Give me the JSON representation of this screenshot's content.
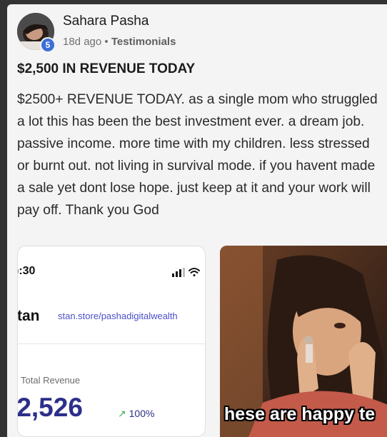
{
  "post": {
    "author": "Sahara Pasha",
    "level": "5",
    "time_ago": "18d ago",
    "separator": "•",
    "category": "Testimonials",
    "title": "$2,500 IN REVENUE TODAY",
    "body": "$2500+ REVENUE TODAY. as a single mom who struggled a lot this has been the best investment ever. a dream job. passive income. more time with my children. less stressed or burnt out. not living in survival mode. if you havent made a sale yet dont lose hope. just keep at it and your work will pay off. Thank you God"
  },
  "attachments": {
    "screenshot": {
      "time": "):30",
      "brand": "ˈtan",
      "store_url": "stan.store/pashadigitalwealth",
      "revenue_label": "Total Revenue",
      "revenue_value": "ˈ2,526",
      "growth": "100%",
      "growth_icon": "trend-up-arrow",
      "status_icons": [
        "signal-icon",
        "wifi-icon"
      ]
    },
    "gif": {
      "caption": "hese are happy te"
    }
  },
  "colors": {
    "background": "#333334",
    "card": "#f4f4f5",
    "badge": "#3b6fd6",
    "store_link": "#4a4fc9",
    "revenue": "#2c2f8a",
    "growth_arrow": "#3fae5c"
  }
}
